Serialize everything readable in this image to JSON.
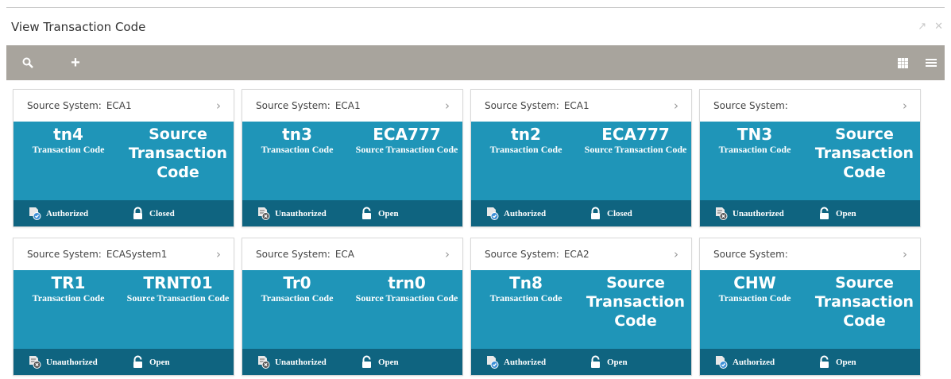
{
  "window": {
    "title": "View Transaction Code",
    "minimize_icon": "collapse-arrows-icon",
    "close_icon": "close-icon"
  },
  "toolbar": {
    "search_icon": "search-icon",
    "add_icon": "plus-icon",
    "grid_view_icon": "grid-view-icon",
    "list_view_icon": "list-view-icon"
  },
  "labels": {
    "source_system": "Source System:",
    "transaction_code": "Transaction Code",
    "source_transaction_code": "Source Transaction Code"
  },
  "cards": [
    {
      "source_system": "ECA1",
      "code": "tn4",
      "source_code": "",
      "auth": "Authorized",
      "lock": "Closed"
    },
    {
      "source_system": "ECA1",
      "code": "tn3",
      "source_code": "ECA777",
      "auth": "Unauthorized",
      "lock": "Open"
    },
    {
      "source_system": "ECA1",
      "code": "tn2",
      "source_code": "ECA777",
      "auth": "Authorized",
      "lock": "Closed"
    },
    {
      "source_system": "",
      "code": "TN3",
      "source_code": "",
      "auth": "Unauthorized",
      "lock": "Open"
    },
    {
      "source_system": "ECASystem1",
      "code": "TR1",
      "source_code": "TRNT01",
      "auth": "Unauthorized",
      "lock": "Open"
    },
    {
      "source_system": "ECA",
      "code": "Tr0",
      "source_code": "trn0",
      "auth": "Unauthorized",
      "lock": "Open"
    },
    {
      "source_system": "ECA2",
      "code": "Tn8",
      "source_code": "",
      "auth": "Authorized",
      "lock": "Open"
    },
    {
      "source_system": "",
      "code": "CHW",
      "source_code": "",
      "auth": "Authorized",
      "lock": "Open"
    }
  ],
  "colors": {
    "toolbar": "#a8a49d",
    "card_body": "#1f95b8",
    "card_footer": "#0f6480"
  }
}
